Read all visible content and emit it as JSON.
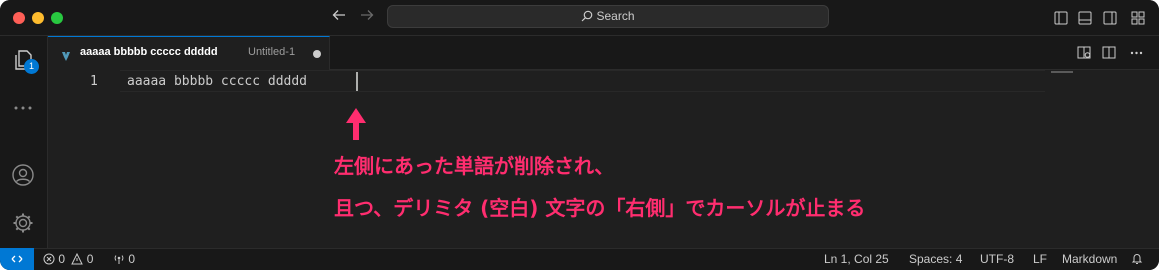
{
  "titlebar": {
    "search_label": "Search"
  },
  "activitybar": {
    "explorer_badge": "1"
  },
  "tab": {
    "label": "aaaaa bbbbb ccccc ddddd",
    "description": "Untitled-1"
  },
  "editor": {
    "line_number": "1",
    "line_text": "aaaaa bbbbb ccccc ddddd "
  },
  "annotation": {
    "line1": "左側にあった単語が削除され、",
    "line2": "且つ、デリミタ (空白) 文字の「右側」でカーソルが止まる",
    "color": "#ff2d6f"
  },
  "statusbar": {
    "errors": "0",
    "warnings": "0",
    "ports": "0",
    "position": "Ln 1, Col 25",
    "indent": "Spaces: 4",
    "encoding": "UTF-8",
    "eol": "LF",
    "language": "Markdown"
  },
  "colors": {
    "accent": "#0078d4",
    "background": "#1f1f1f"
  }
}
